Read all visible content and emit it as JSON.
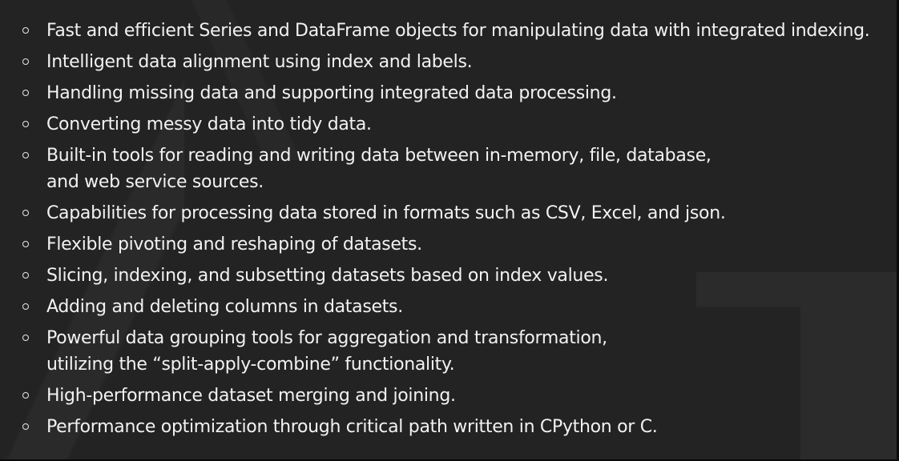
{
  "bullets": [
    {
      "lines": [
        "Fast and efficient Series and DataFrame objects for manipulating data with integrated indexing."
      ]
    },
    {
      "lines": [
        "Intelligent data alignment using index and labels."
      ]
    },
    {
      "lines": [
        "Handling missing data and supporting integrated data processing."
      ]
    },
    {
      "lines": [
        "Converting messy data into tidy data."
      ]
    },
    {
      "lines": [
        "Built-in tools for reading and writing data between in-memory, file, database,",
        "and web service sources."
      ]
    },
    {
      "lines": [
        "Capabilities for processing data stored in formats such as CSV, Excel, and json."
      ]
    },
    {
      "lines": [
        "Flexible pivoting and reshaping of datasets."
      ]
    },
    {
      "lines": [
        "Slicing, indexing, and subsetting datasets based on index values."
      ]
    },
    {
      "lines": [
        "Adding and deleting columns in datasets."
      ]
    },
    {
      "lines": [
        "Powerful data grouping tools for aggregation and transformation,",
        "utilizing the “split-apply-combine” functionality."
      ]
    },
    {
      "lines": [
        "High-performance dataset merging and joining."
      ]
    },
    {
      "lines": [
        "Performance optimization through critical path written in CPython or C."
      ]
    }
  ],
  "icons": {
    "bullet_marker": "hollow-circle-icon"
  },
  "colors": {
    "background": "#232323",
    "text": "#f2f2f2"
  }
}
